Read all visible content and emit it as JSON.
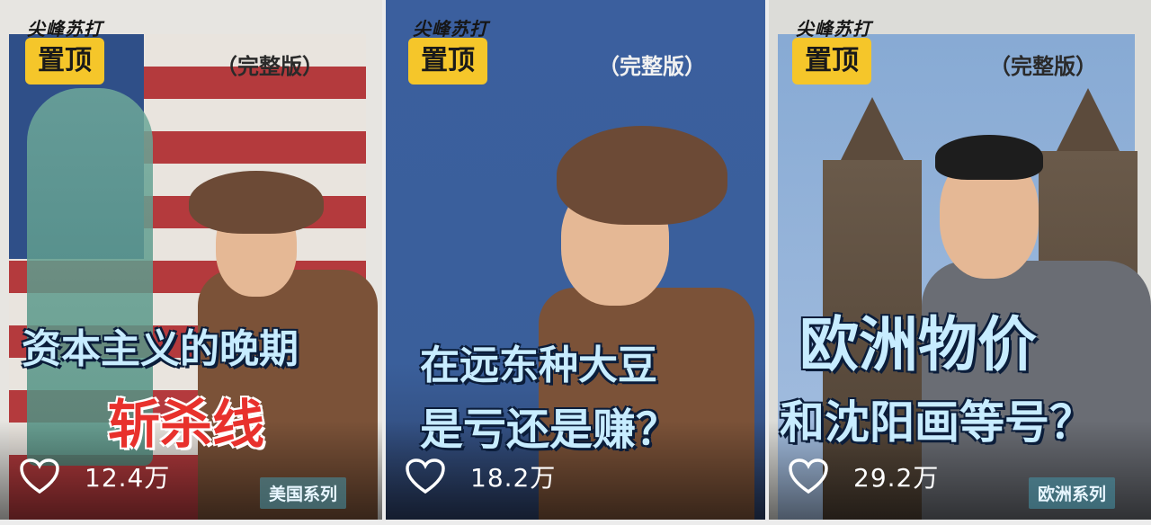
{
  "cards": [
    {
      "brand": "尖峰苏打",
      "pin_label": "置顶",
      "edition": "（完整版）",
      "headline_line1": "资本主义的晚期",
      "headline_line2": "斩杀线",
      "likes": "12.4万",
      "series": "美国系列"
    },
    {
      "brand": "尖峰苏打",
      "pin_label": "置顶",
      "edition": "（完整版）",
      "headline_line1": "在远东种大豆",
      "headline_line2": "是亏还是赚？",
      "likes": "18.2万",
      "series": ""
    },
    {
      "brand": "尖峰苏打",
      "pin_label": "置顶",
      "edition": "（完整版）",
      "headline_line1": "欧洲物价",
      "headline_line2": "和沈阳画等号？",
      "likes": "29.2万",
      "series": "欧洲系列"
    }
  ],
  "colors": {
    "pin_badge": "#f5c62a",
    "headline_red": "#e8312c",
    "headline_outline": "#0b1d3a"
  },
  "icons": [
    "heart-icon"
  ]
}
